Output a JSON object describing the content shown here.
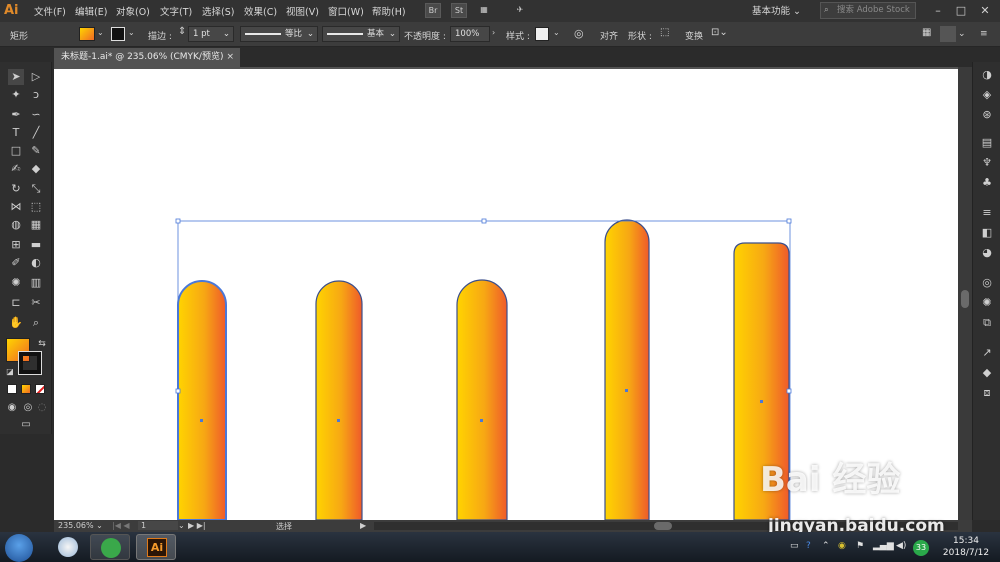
{
  "app": {
    "logo": "Ai"
  },
  "menubar": {
    "items": [
      "文件(F)",
      "编辑(E)",
      "对象(O)",
      "文字(T)",
      "选择(S)",
      "效果(C)",
      "视图(V)",
      "窗口(W)",
      "帮助(H)"
    ],
    "bridge": "Br",
    "stock": "St",
    "workspace": "基本功能",
    "search_placeholder": "搜索 Adobe Stock"
  },
  "control_bar": {
    "object_type": "矩形",
    "stroke_label": "描边 :",
    "stroke_weight": "1 pt",
    "profile_label": "等比",
    "brush_label": "基本",
    "opacity_label": "不透明度 :",
    "opacity_value": "100%",
    "style_label": "样式 :",
    "align_label": "对齐",
    "shape_label": "形状 :",
    "transform_label": "变换"
  },
  "document": {
    "tab_title": "未标题-1.ai* @ 235.06% (CMYK/预览)",
    "close": "×"
  },
  "statusbar": {
    "zoom": "235.06%",
    "artboard": "1",
    "tool": "选择"
  },
  "taskbar": {
    "ai_label": "Ai",
    "tray_badge": "33",
    "time": "15:34",
    "date": "2018/7/12"
  },
  "watermark": {
    "main": "Bai 经验",
    "url": "jingyan.baidu.com"
  },
  "colors": {
    "gradient_start": "#ffd400",
    "gradient_end": "#f06a24",
    "bar_outline": "#3b4f8c",
    "selection": "#4a78d8"
  }
}
